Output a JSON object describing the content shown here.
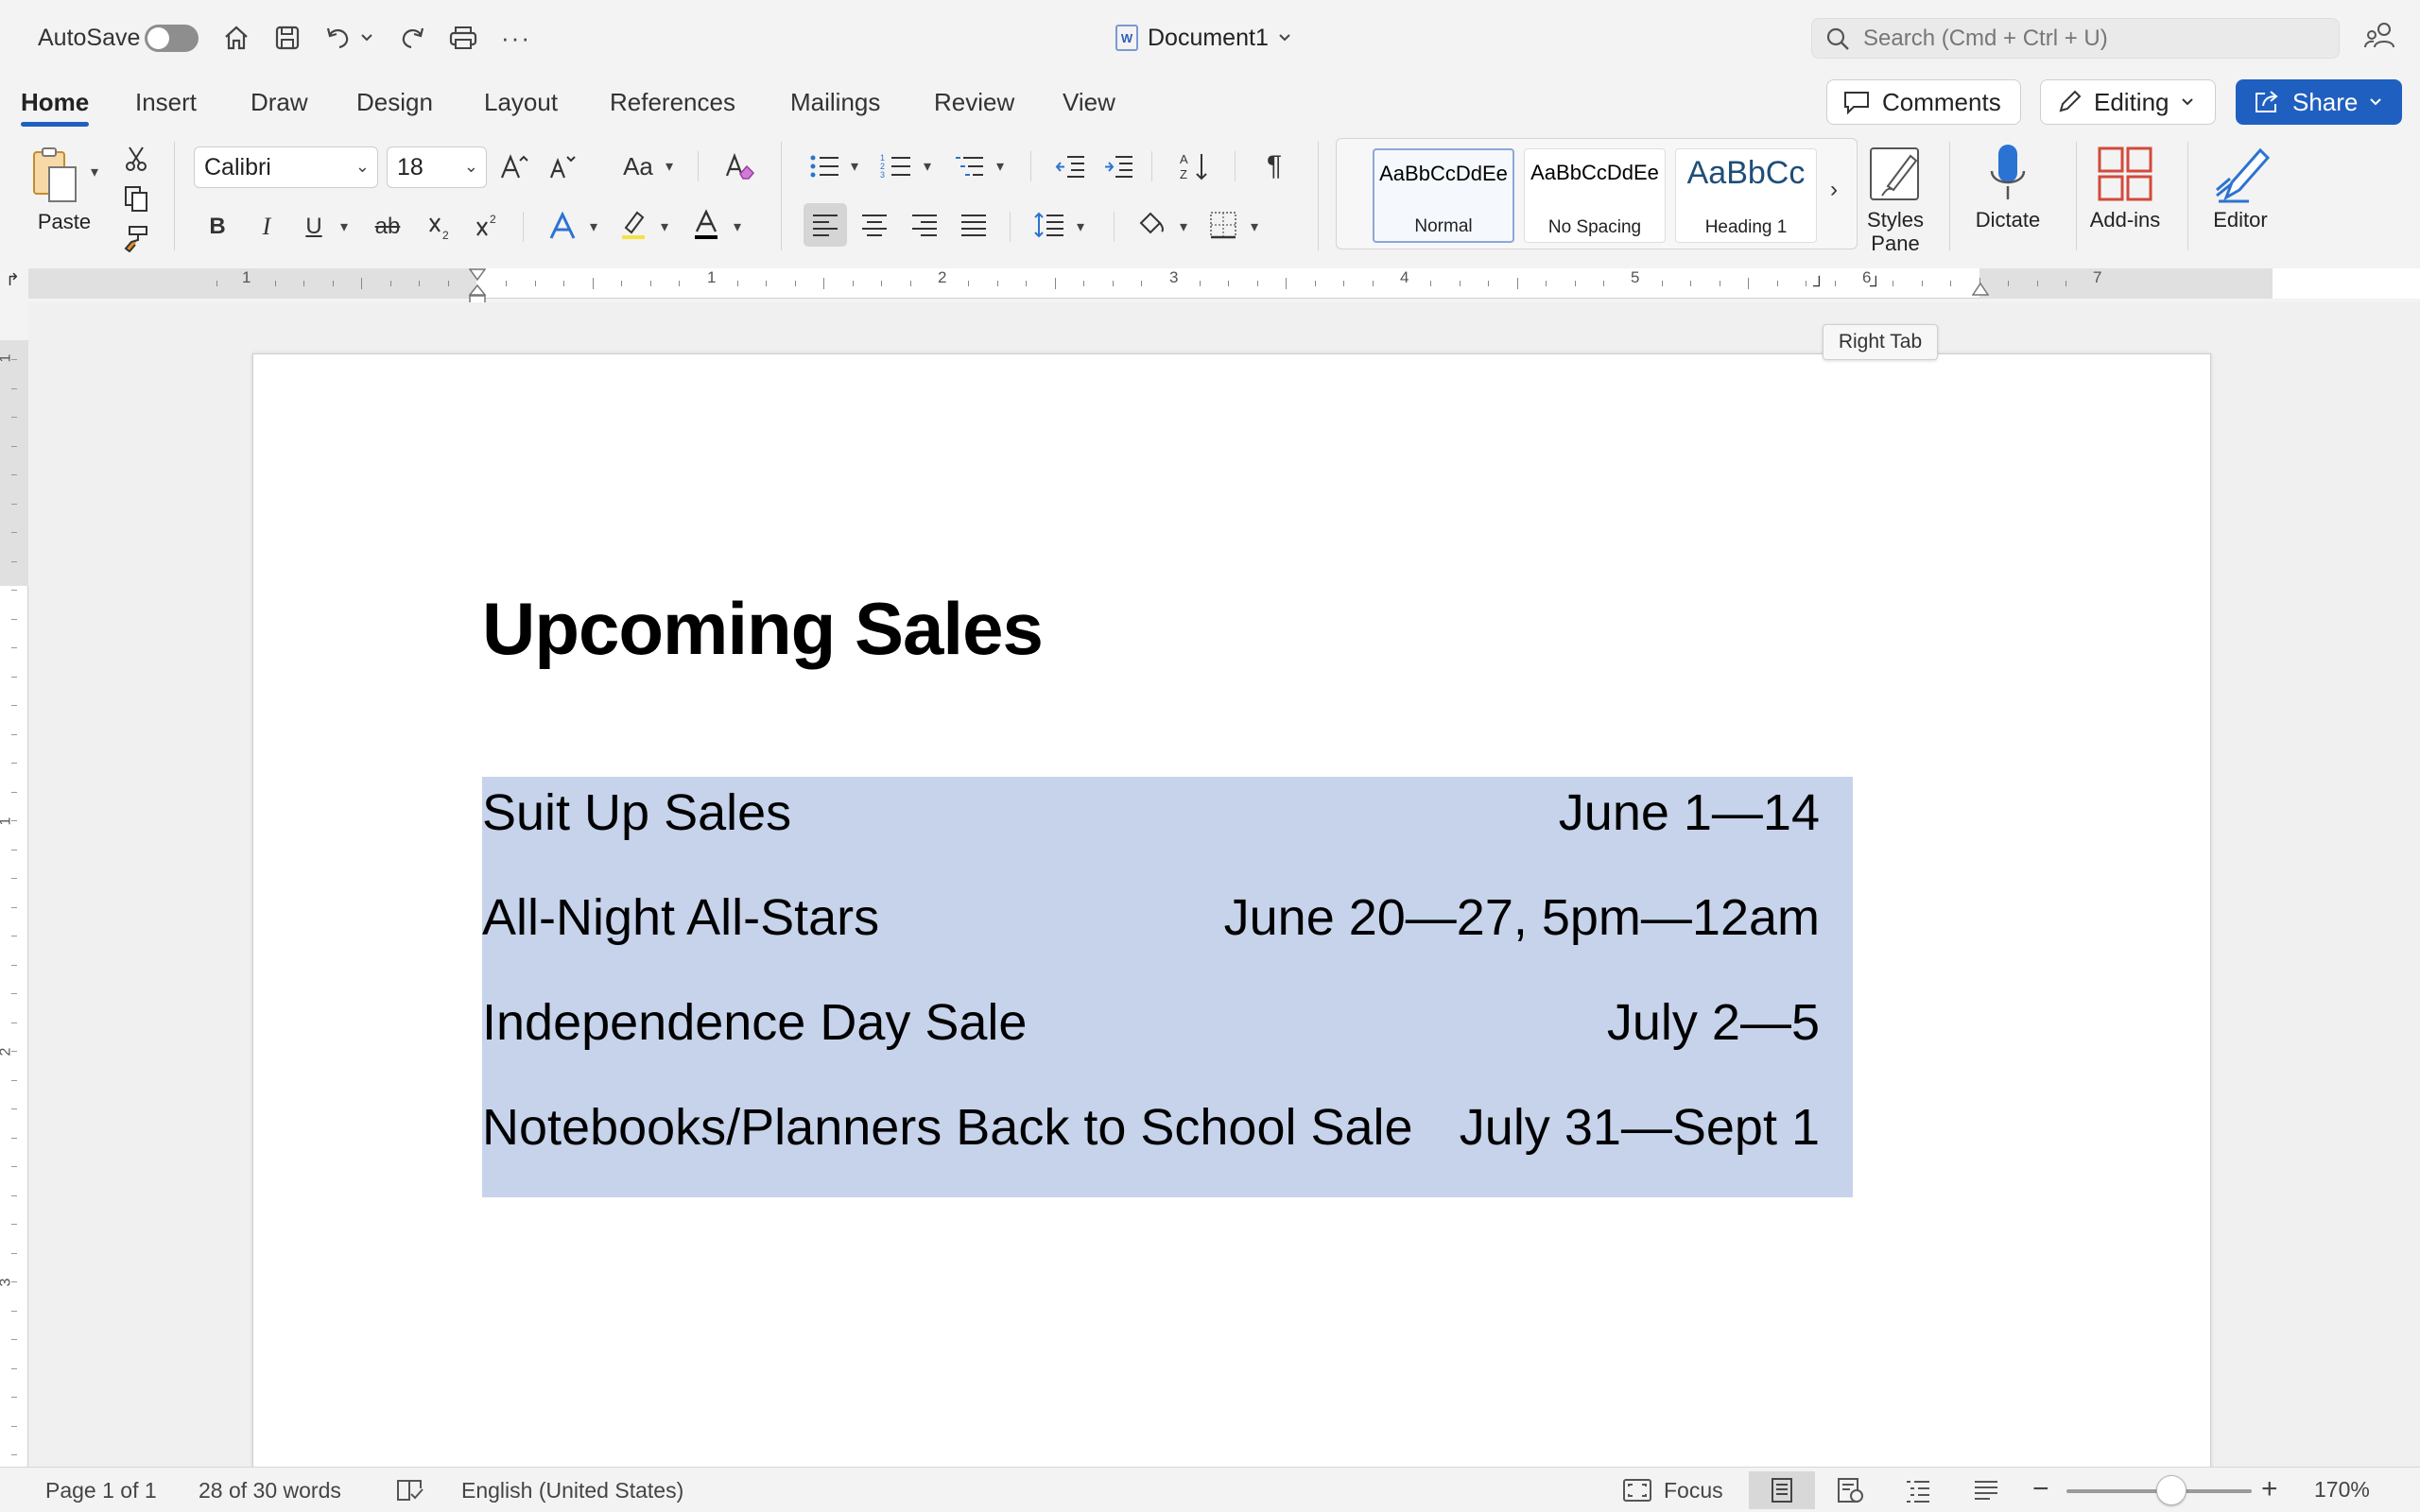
{
  "titlebar": {
    "autosave_label": "AutoSave",
    "document_name": "Document1",
    "search_placeholder": "Search (Cmd + Ctrl + U)"
  },
  "tabs": [
    {
      "label": "Home",
      "active": true
    },
    {
      "label": "Insert"
    },
    {
      "label": "Draw"
    },
    {
      "label": "Design"
    },
    {
      "label": "Layout"
    },
    {
      "label": "References"
    },
    {
      "label": "Mailings"
    },
    {
      "label": "Review"
    },
    {
      "label": "View"
    }
  ],
  "actions": {
    "comments": "Comments",
    "editing": "Editing",
    "share": "Share"
  },
  "ribbon": {
    "paste_label": "Paste",
    "font_name": "Calibri",
    "font_size": "18",
    "change_case": "Aa",
    "bold": "B",
    "italic": "I",
    "underline": "U",
    "strikethrough": "ab",
    "styles": [
      {
        "preview": "AaBbCcDdEe",
        "name": "Normal",
        "selected": true
      },
      {
        "preview": "AaBbCcDdEe",
        "name": "No Spacing"
      },
      {
        "preview": "AaBbCc",
        "name": "Heading 1"
      }
    ],
    "styles_pane_label": "Styles\nPane",
    "dictate_label": "Dictate",
    "addins_label": "Add-ins",
    "editor_label": "Editor"
  },
  "ruler": {
    "numbers": [
      "1",
      "1",
      "2",
      "3",
      "4",
      "5",
      "6",
      "7"
    ],
    "vertical_numbers": [
      "1",
      "1",
      "2",
      "3"
    ]
  },
  "tooltip": "Right Tab",
  "document": {
    "heading": "Upcoming Sales",
    "rows": [
      {
        "name": "Suit Up Sales",
        "date": "June 1—14"
      },
      {
        "name": "All-Night All-Stars",
        "date": "June 20—27, 5pm—12am"
      },
      {
        "name": "Independence Day Sale",
        "date": "July 2—5"
      },
      {
        "name": "Notebooks/Planners Back to School Sale",
        "date": "July 31—Sept 1"
      }
    ]
  },
  "status": {
    "page": "Page 1 of 1",
    "words": "28 of 30 words",
    "language": "English (United States)",
    "focus": "Focus",
    "zoom": "170%"
  },
  "colors": {
    "accent": "#1f5fbf",
    "selection": "#c6d3eb"
  }
}
